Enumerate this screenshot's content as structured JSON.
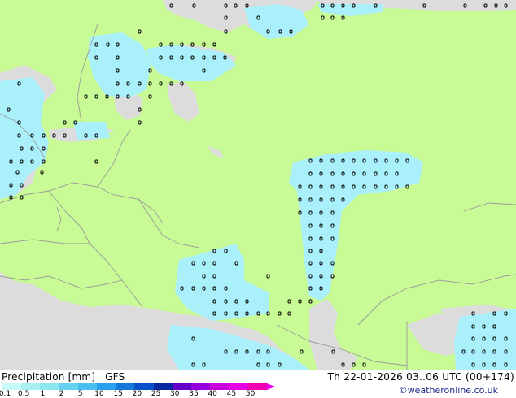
{
  "caption": {
    "title_left": "Precipitation [mm]",
    "model": "GFS",
    "date": "Th 22-01-2026 03..06 UTC (00+174)",
    "credit": "©weatheronline.co.uk"
  },
  "legend": {
    "ticks": [
      "0.1",
      "0.5",
      "1",
      "2",
      "5",
      "10",
      "15",
      "20",
      "25",
      "30",
      "35",
      "40",
      "45",
      "50"
    ],
    "colors": [
      "#c8fafa",
      "#aaf0f0",
      "#8ce6f0",
      "#64d2f0",
      "#46bef0",
      "#28a0f0",
      "#1478dc",
      "#0a50c8",
      "#0a28a0",
      "#6400c8",
      "#9600dc",
      "#c800dc",
      "#e600e6",
      "#f000b4"
    ]
  },
  "colors": {
    "land": "#c8fa96",
    "sea": "#dcdcdc",
    "precip_light": "#aaf0fa",
    "border": "#9a9a9a",
    "marker": "#000000"
  }
}
